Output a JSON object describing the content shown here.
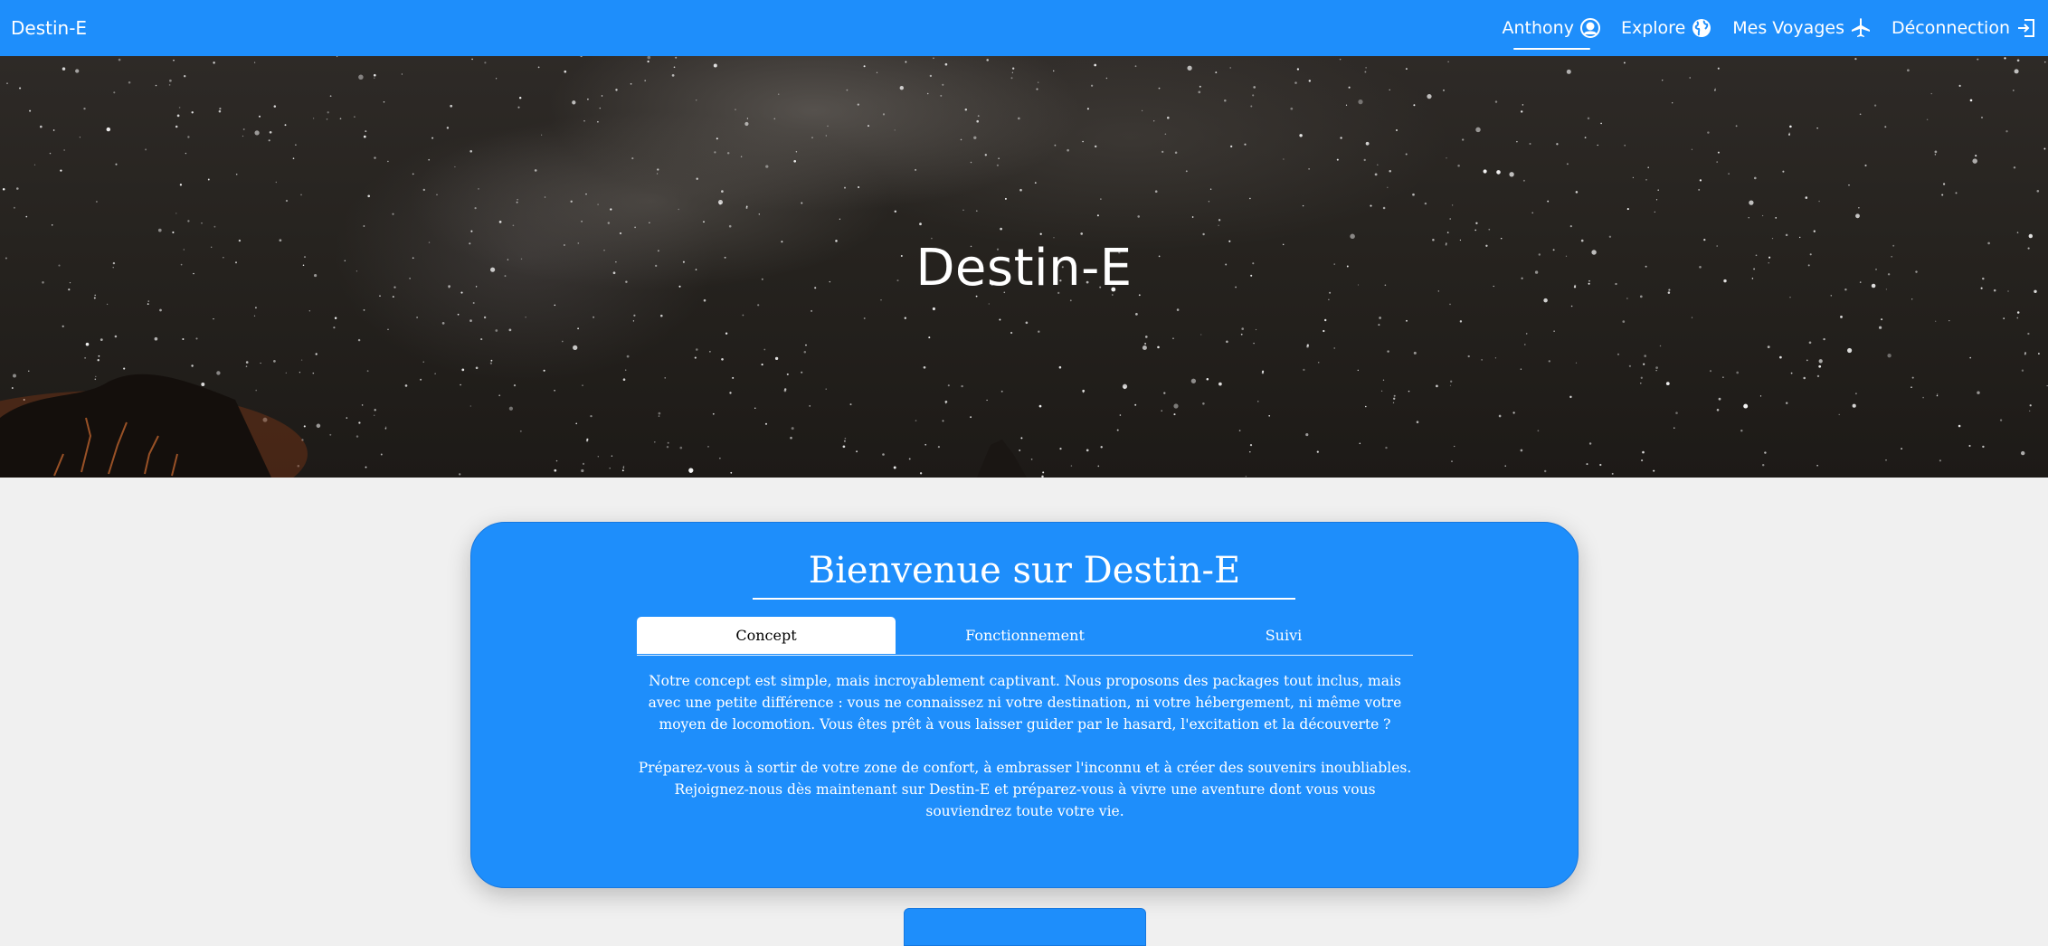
{
  "nav": {
    "brand": "Destin-E",
    "links": [
      {
        "label": "Anthony",
        "icon": "user-circle-icon"
      },
      {
        "label": "Explore",
        "icon": "globe-icon"
      },
      {
        "label": "Mes Voyages",
        "icon": "airplane-icon"
      },
      {
        "label": "Déconnection",
        "icon": "logout-icon"
      }
    ]
  },
  "hero": {
    "title": "Destin-E"
  },
  "welcome": {
    "title": "Bienvenue sur Destin-E",
    "tabs": [
      {
        "label": "Concept"
      },
      {
        "label": "Fonctionnement"
      },
      {
        "label": "Suivi"
      }
    ],
    "active_tab": "Concept",
    "paragraph1": "Notre concept est simple, mais incroyablement captivant. Nous proposons des packages tout inclus, mais avec une petite différence : vous ne connaissez ni votre destination, ni votre hébergement, ni même votre moyen de locomotion. Vous êtes prêt à vous laisser guider par le hasard, l'excitation et la découverte ?",
    "paragraph2": "Préparez-vous à sortir de votre zone de confort, à embrasser l'inconnu et à créer des souvenirs inoubliables. Rejoignez-nous dès maintenant sur Destin-E et préparez-vous à vivre une aventure dont vous vous souviendrez toute votre vie."
  },
  "colors": {
    "primary": "#1e8efb",
    "background": "#f0f0f0",
    "hero_dark": "#26231f"
  }
}
